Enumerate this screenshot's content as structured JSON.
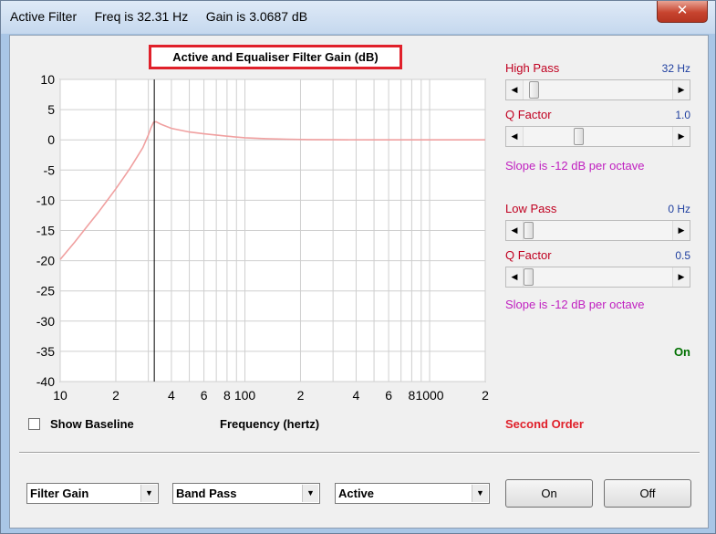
{
  "window": {
    "title": "Active Filter     Freq is 32.31 Hz     Gain is 3.0687 dB",
    "close_glyph": "✕"
  },
  "chart_data": {
    "type": "line",
    "title": "Active and Equaliser Filter Gain (dB)",
    "xlabel": "Frequency (hertz)",
    "ylabel": "",
    "x_scale": "log",
    "xlim": [
      10,
      200
    ],
    "ylim": [
      -40,
      10
    ],
    "y_ticks": [
      10,
      5,
      0,
      -5,
      -10,
      -15,
      -20,
      -25,
      -30,
      -35,
      -40
    ],
    "x_tick_labels": [
      {
        "x": 10,
        "label": "10"
      },
      {
        "x": 20,
        "label": "2"
      },
      {
        "x": 40,
        "label": "4"
      },
      {
        "x": 60,
        "label": "6"
      },
      {
        "x": 80,
        "label": "8"
      },
      {
        "x": 100,
        "label": "100"
      },
      {
        "x": 200,
        "label": "2"
      },
      {
        "x": 400,
        "label": "4"
      },
      {
        "x": 600,
        "label": "6"
      },
      {
        "x": 800,
        "label": "8"
      },
      {
        "x": 1000,
        "label": "1000"
      },
      {
        "x": 2000,
        "label": "2"
      }
    ],
    "cursor_x": 32.31,
    "series": [
      {
        "color": "#f0a0a0",
        "x": [
          10,
          12,
          14,
          16,
          18,
          20,
          22,
          24,
          26,
          28,
          30,
          31,
          32,
          33,
          35,
          40,
          50,
          60,
          80,
          100,
          130,
          170,
          220,
          300,
          500,
          1000,
          2000
        ],
        "y": [
          -19.8,
          -16.9,
          -14.3,
          -12.1,
          -10.0,
          -8.1,
          -6.3,
          -4.6,
          -2.9,
          -1.3,
          0.8,
          2.0,
          2.9,
          3.0,
          2.6,
          1.9,
          1.3,
          1.0,
          0.6,
          0.35,
          0.2,
          0.1,
          0.05,
          0.02,
          0.0,
          0.0,
          0.0
        ]
      }
    ],
    "grid": true
  },
  "show_baseline_label": "Show Baseline",
  "order_label": "Second Order",
  "high_pass": {
    "label": "High Pass",
    "value": "32 Hz",
    "position": 0.04
  },
  "high_q": {
    "label": "Q Factor",
    "value": "1.0",
    "position": 0.36
  },
  "high_slope": "Slope is -12 dB per octave",
  "low_pass": {
    "label": "Low Pass",
    "value": "0 Hz",
    "position": 0.0
  },
  "low_q": {
    "label": "Q Factor",
    "value": "0.5",
    "position": 0.0
  },
  "low_slope": "Slope is -12 dB per octave",
  "status_on": "On",
  "controls": {
    "mode": "Filter Gain",
    "filter_type": "Band Pass",
    "filter_kind": "Active",
    "on_button": "On",
    "off_button": "Off"
  },
  "colors": {
    "curve": "#f0a0a0",
    "red_labels": "#c00020",
    "blue_values": "#2040a0",
    "magenta": "#c020c0",
    "on_green": "#007000"
  }
}
